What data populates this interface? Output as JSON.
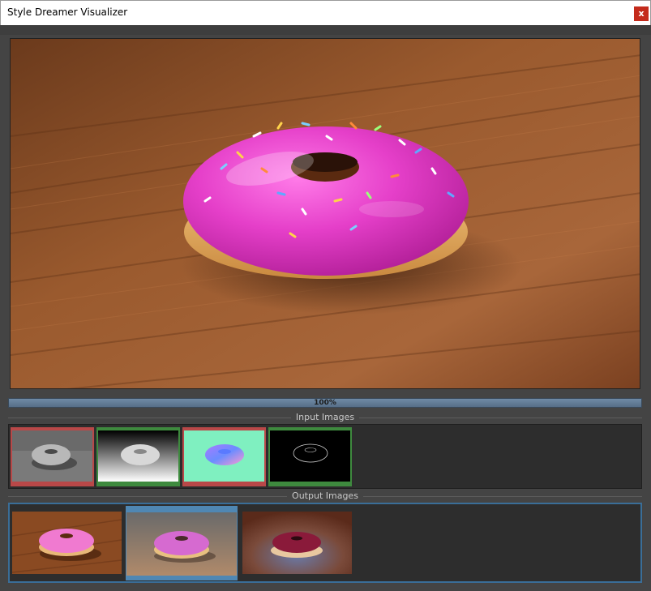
{
  "window": {
    "title": "Style Dreamer Visualizer",
    "close_label": "x"
  },
  "progress": {
    "label": "100%",
    "value": 1.0
  },
  "input_section": {
    "label": "Input Images"
  },
  "output_section": {
    "label": "Output Images"
  },
  "inputs": [
    {
      "name": "rendered-grey-donut",
      "status": "error",
      "border_color": "#b94848"
    },
    {
      "name": "depth-map-donut",
      "status": "ok",
      "border_color": "#3e8a3e"
    },
    {
      "name": "normal-map-donut",
      "status": "error",
      "border_color": "#b94848"
    },
    {
      "name": "edge-map-donut",
      "status": "ok",
      "border_color": "#3e8a3e"
    }
  ],
  "outputs": [
    {
      "name": "output-pink-donut-wood",
      "selected": false
    },
    {
      "name": "output-pink-donut-stylized",
      "selected": true
    },
    {
      "name": "output-purple-donut-rustic",
      "selected": false
    }
  ],
  "colors": {
    "selected": "#4f87b3",
    "accent": "#3a6e98"
  }
}
